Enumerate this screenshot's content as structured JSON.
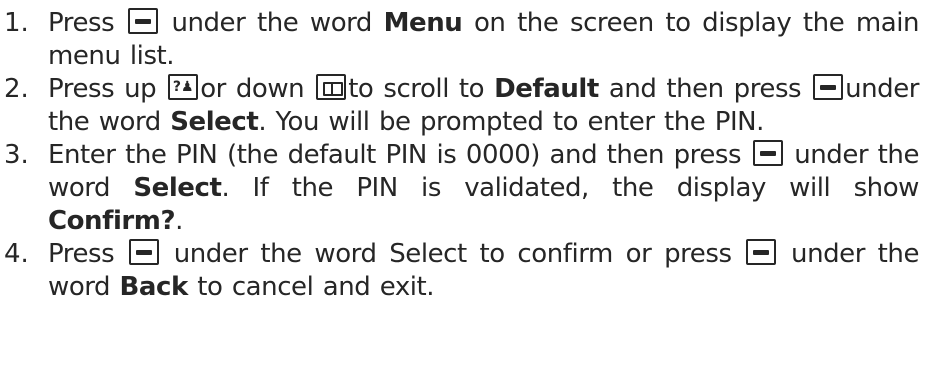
{
  "steps": [
    {
      "number": "1.",
      "p1": "Press",
      "p2": "under the word",
      "b1": "Menu",
      "p3": "on the screen to display the main menu list."
    },
    {
      "number": "2.",
      "p1": "Press up",
      "up_key_glyph": "?♟",
      "p2": "or down",
      "p3": "to scroll to",
      "b1": "Default",
      "p4": "and then press",
      "p5": "under the word",
      "b2": "Select",
      "p6": ". You will be prompted to enter the PIN."
    },
    {
      "number": "3.",
      "p1": "Enter the PIN (the default PIN is 0000) and then press",
      "p2": "under the word",
      "b1": "Select",
      "p3": ". If the PIN is validated, the display will show",
      "b2": "Confirm?",
      "p4": "."
    },
    {
      "number": "4.",
      "p1": "Press",
      "p2": "under the word Select to confirm or press",
      "p3": "under the word",
      "b1": "Back",
      "p4": "to cancel and exit."
    }
  ],
  "icons": {
    "soft_key": "soft-key-icon",
    "up_key": "up-key-icon",
    "down_key": "down-key-icon"
  }
}
